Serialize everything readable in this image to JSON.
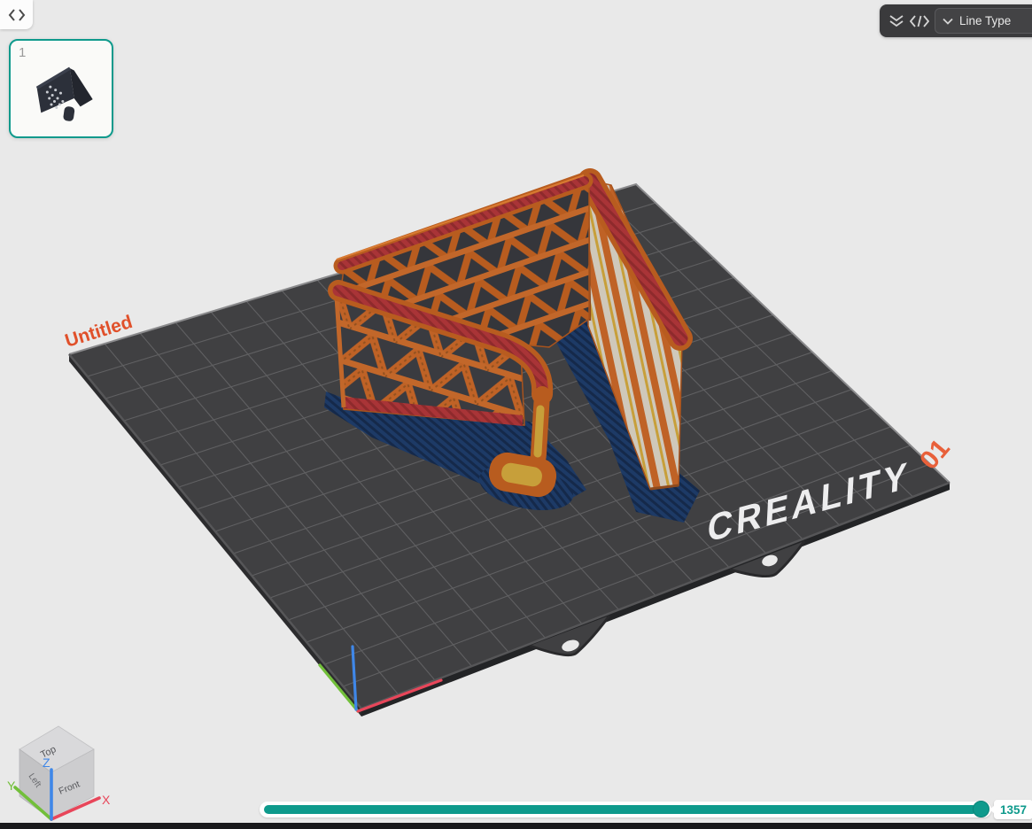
{
  "window": {
    "collapse_icon": "chevrons-left-right"
  },
  "plate_card": {
    "number": "1",
    "thumbnail": "sliced-model-thumbnail"
  },
  "view_toolbar": {
    "icons": [
      "double-chevron-down",
      "code-brackets"
    ],
    "line_type": {
      "label": "Line Type",
      "icon": "chevron-down"
    }
  },
  "scene": {
    "plate_name": "Untitled",
    "plate_number": "01",
    "plate_brand": "CREALITY"
  },
  "view_cube": {
    "faces": {
      "top": "Top",
      "left": "Left",
      "front": "Front"
    },
    "axes": {
      "x": "X",
      "y": "Y",
      "z": "Z"
    }
  },
  "layer_slider": {
    "value": "1357"
  },
  "colors": {
    "accent_teal": "#0e9a8c",
    "label_orange": "#e0502a",
    "toolbar_dark": "#3a3a3c",
    "plate_dark": "#404042",
    "model_outer_wall": "#bf6226",
    "model_top_surface": "#a93437",
    "model_shadow_navy": "#1d3a66",
    "model_support_yellow": "#c79f3a",
    "axis_x_red": "#e8465a",
    "axis_y_green": "#72bf3a",
    "axis_z_blue": "#3f87e8"
  }
}
